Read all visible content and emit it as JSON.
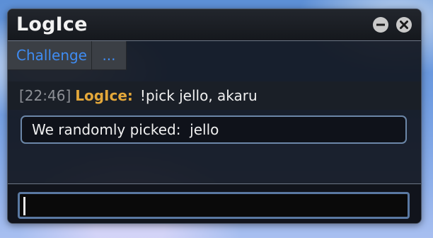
{
  "window": {
    "title": "LogIce"
  },
  "controls": {
    "minimize_icon": "minus-circle-icon",
    "close_icon": "x-circle-icon"
  },
  "tabs": [
    {
      "label": "Challenge"
    },
    {
      "label": "..."
    }
  ],
  "messages": [
    {
      "timestamp": "[22:46]",
      "author": "LogIce:",
      "text": "!pick jello, akaru"
    }
  ],
  "reply": {
    "text": "We randomly picked:  jello"
  },
  "chat_input": {
    "value": ""
  },
  "colors": {
    "tab_text": "#3f8cf2",
    "author": "#e3a73a",
    "timestamp": "#8d9096",
    "border": "#6c87a8"
  }
}
